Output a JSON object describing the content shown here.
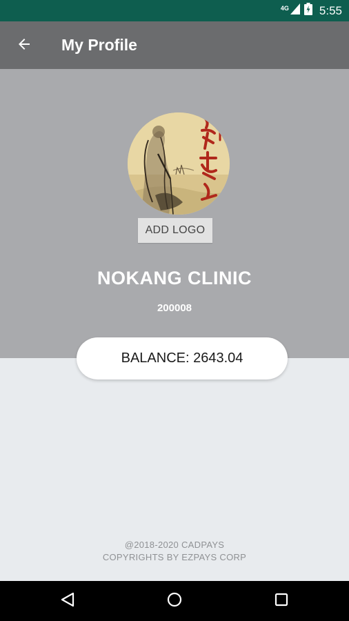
{
  "status_bar": {
    "network": "4G",
    "time": "5:55",
    "icons": [
      "signal-icon",
      "battery-icon"
    ]
  },
  "app_bar": {
    "back_icon": "arrow-back-icon",
    "title": "My Profile"
  },
  "profile": {
    "avatar": "clinic-logo-painting",
    "add_logo_label": "ADD LOGO",
    "name": "NOKANG CLINIC",
    "id": "200008",
    "balance_text": "BALANCE: 2643.04"
  },
  "footer": {
    "line1": "@2018-2020 CADPAYS",
    "line2": "COPYRIGHTS BY EZPAYS CORP"
  },
  "nav_bar": {
    "icons": [
      "back-triangle-icon",
      "home-circle-icon",
      "recents-square-icon"
    ]
  },
  "colors": {
    "status_bar": "#0e5e4f",
    "app_bar": "#6b6c6e",
    "header_panel": "#a9aaad",
    "background": "#e8ebee",
    "nav_bar": "#000000"
  }
}
